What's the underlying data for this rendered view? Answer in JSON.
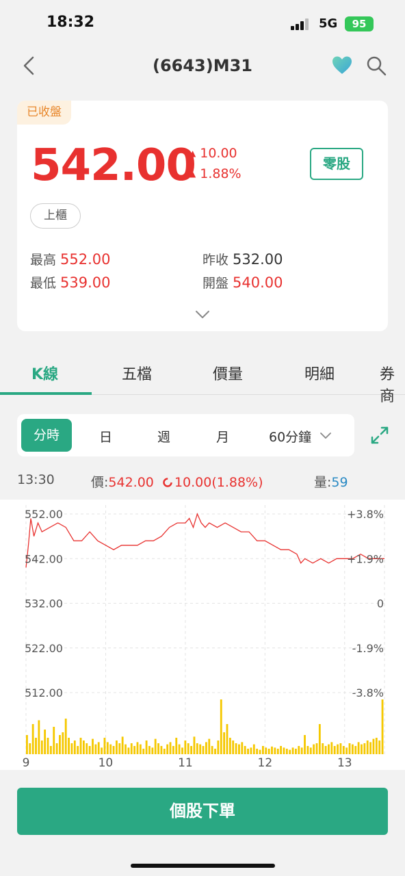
{
  "status": {
    "time": "18:32",
    "network": "5G",
    "battery": "95"
  },
  "nav": {
    "title": "(6643)M31",
    "back_icon": "chevron-left-icon",
    "favorite_icon": "heart-icon",
    "search_icon": "search-icon"
  },
  "quote": {
    "status_badge": "已收盤",
    "price": "542.00",
    "change": "10.00",
    "change_pct": "1.88%",
    "odd_lot_label": "零股",
    "market_tag": "上櫃",
    "high_label": "最高",
    "high": "552.00",
    "low_label": "最低",
    "low": "539.00",
    "prev_close_label": "昨收",
    "prev_close": "532.00",
    "open_label": "開盤",
    "open": "540.00"
  },
  "tabs": [
    "K線",
    "五檔",
    "價量",
    "明細",
    "券商"
  ],
  "active_tab": 0,
  "periods": [
    "分時",
    "日",
    "週",
    "月",
    "60分鐘"
  ],
  "active_period": 0,
  "info": {
    "time": "13:30",
    "price_label": "價:",
    "price": "542.00",
    "change": "10.00(1.88%)",
    "volume_label": "量:",
    "volume": "59"
  },
  "chart_data": {
    "type": "line",
    "y_ticks_left": [
      "552.00",
      "542.00",
      "532.00",
      "522.00",
      "512.00"
    ],
    "y_ticks_right": [
      "+3.8%",
      "+1.9%",
      "0",
      "-1.9%",
      "-3.8%"
    ],
    "ylim": [
      512,
      552
    ],
    "x_ticks": [
      "9",
      "10",
      "11",
      "12",
      "13"
    ],
    "xlim": [
      9,
      13.5
    ],
    "price_series": {
      "x": [
        9.0,
        9.03,
        9.06,
        9.1,
        9.15,
        9.2,
        9.3,
        9.4,
        9.5,
        9.6,
        9.7,
        9.8,
        9.9,
        10.0,
        10.1,
        10.2,
        10.3,
        10.4,
        10.5,
        10.6,
        10.7,
        10.8,
        10.9,
        11.0,
        11.05,
        11.1,
        11.15,
        11.2,
        11.25,
        11.3,
        11.4,
        11.5,
        11.6,
        11.7,
        11.8,
        11.9,
        12.0,
        12.1,
        12.2,
        12.3,
        12.4,
        12.45,
        12.5,
        12.6,
        12.7,
        12.8,
        12.9,
        13.0,
        13.1,
        13.2,
        13.3,
        13.4,
        13.5
      ],
      "values": [
        540,
        545,
        551,
        547,
        550,
        548,
        549,
        550,
        549,
        546,
        546,
        548,
        546,
        545,
        544,
        545,
        545,
        545,
        546,
        546,
        547,
        549,
        550,
        550,
        551,
        549,
        552,
        550,
        549,
        550,
        549,
        550,
        549,
        548,
        548,
        546,
        546,
        545,
        544,
        544,
        543,
        541,
        542,
        541,
        542,
        541,
        542,
        542,
        542,
        543,
        542,
        542,
        542
      ]
    },
    "reference_price": 532.0,
    "volume_bars": [
      0.35,
      0.2,
      0.55,
      0.3,
      0.62,
      0.25,
      0.45,
      0.3,
      0.15,
      0.5,
      0.2,
      0.35,
      0.4,
      0.65,
      0.3,
      0.2,
      0.25,
      0.15,
      0.3,
      0.25,
      0.2,
      0.15,
      0.28,
      0.18,
      0.22,
      0.12,
      0.3,
      0.22,
      0.18,
      0.15,
      0.25,
      0.2,
      0.32,
      0.18,
      0.12,
      0.2,
      0.15,
      0.22,
      0.18,
      0.1,
      0.25,
      0.15,
      0.12,
      0.28,
      0.2,
      0.15,
      0.1,
      0.18,
      0.22,
      0.15,
      0.3,
      0.18,
      0.12,
      0.25,
      0.2,
      0.15,
      0.32,
      0.2,
      0.18,
      0.15,
      0.22,
      0.28,
      0.15,
      0.1,
      0.25,
      1.0,
      0.4,
      0.55,
      0.3,
      0.25,
      0.2,
      0.18,
      0.22,
      0.15,
      0.1,
      0.12,
      0.18,
      0.1,
      0.08,
      0.15,
      0.12,
      0.1,
      0.14,
      0.12,
      0.1,
      0.15,
      0.12,
      0.1,
      0.08,
      0.12,
      0.1,
      0.15,
      0.12,
      0.35,
      0.15,
      0.12,
      0.18,
      0.2,
      0.55,
      0.2,
      0.15,
      0.18,
      0.22,
      0.15,
      0.18,
      0.2,
      0.15,
      0.12,
      0.2,
      0.18,
      0.15,
      0.22,
      0.18,
      0.2,
      0.25,
      0.22,
      0.28,
      0.3,
      0.25,
      1.0
    ],
    "line_color": "#e8312f",
    "bar_color": "#f5c800"
  },
  "order_button": "個股下單"
}
